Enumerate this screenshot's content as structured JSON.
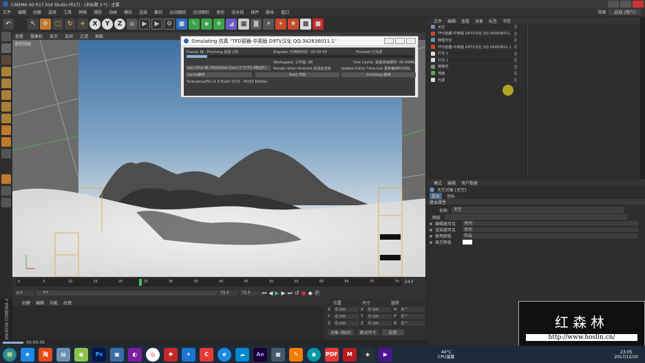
{
  "window_title": "CINEMA 4D R17.016 Studio (R17) - [未标题 3 *] - 主要",
  "menu": [
    "文件",
    "编辑",
    "创建",
    "选择",
    "工具",
    "网格",
    "捕捉",
    "动画",
    "模拟",
    "渲染",
    "雕刻",
    "运动跟踪",
    "运动图形",
    "角色",
    "流水线",
    "插件",
    "脚本",
    "窗口"
  ],
  "right_top": {
    "layout_label": "界面",
    "layout_value": "启动 (用户)"
  },
  "viewport": {
    "menu": [
      "查看",
      "摄像机",
      "显示",
      "选项",
      "过滤",
      "面板"
    ],
    "label": "透视视图"
  },
  "dialog": {
    "title": "Simulating 仿真 \"TFD容器-中英版 D9TV汉化 QQ:342836011.1\"",
    "frame": "Frame: 帧 , Finishing 完成 2间",
    "elapsed": "Elapsed: 已用的时间 : 00:00:40",
    "finished": "Finished 已完成",
    "workspace": "Workspace: 工作室: 08",
    "disk_cache": "Disk Cache: 磁盘高速缓存: 89.66MB",
    "cpu_select": "Use CPUs 用 CPUs(Intel Core i7-3770 4核/8T)",
    "render_check": "Render when finished 完成后渲染",
    "update_check": "Update Editor Time-line 更新编辑时间线(",
    "cache_select": "Cache缓存",
    "start_btn": "Start 开始",
    "continue_btn": "Continue 继续",
    "footer": "TurbulenceFD v1.0 Build 1372 - MUS3 Edition"
  },
  "objects": {
    "tabs": [
      "文件",
      "编辑",
      "查看",
      "对象",
      "标签",
      "书签"
    ],
    "items": [
      "天空",
      "TFD容器-中英版 D9TV汉化 QQ:342836011.1",
      "物理天空",
      "TFD容器-中英版 D9TV汉化 QQ:34283601.1",
      "灯光.1",
      "灯光.1",
      "摄像机",
      "地面",
      "光源"
    ]
  },
  "attributes": {
    "tabs": [
      "模式",
      "编辑",
      "用户数据"
    ],
    "object_label": "天空对象 [天空]",
    "subtabs": [
      "基本",
      "坐标"
    ],
    "section": "基本属性",
    "name_label": "名称",
    "name_value": "天空",
    "layer_label": "图层",
    "rows": [
      {
        "label": "编辑器可见",
        "value": "关闭"
      },
      {
        "label": "渲染器可见",
        "value": "关闭"
      },
      {
        "label": "使用颜色",
        "value": "开启"
      },
      {
        "label": "显示颜色",
        "value": ""
      }
    ]
  },
  "timeline": {
    "ticks": [
      "0",
      "5",
      "10",
      "15",
      "20",
      "25",
      "30",
      "35",
      "40",
      "45",
      "50",
      "55",
      "60",
      "65",
      "70",
      "75"
    ],
    "start": "0 F",
    "end": "75 F",
    "current": "0 F",
    "fps_label": "24 F",
    "end2": "75 F"
  },
  "bottom": {
    "menu": [
      "创建",
      "编辑",
      "功能",
      "纹理"
    ],
    "coord_headers": [
      "位置",
      "尺寸",
      "旋转"
    ],
    "coords": [
      [
        "X",
        "0 cm",
        "X",
        "0 cm",
        "H",
        "0 °"
      ],
      [
        "Y",
        "0 cm",
        "Y",
        "0 cm",
        "P",
        "0 °"
      ],
      [
        "Z",
        "0 cm",
        "Z",
        "0 cm",
        "B",
        "0 °"
      ]
    ],
    "object_mode": "对象 (相对)",
    "size_mode": "绝对尺寸",
    "apply_btn": "应用",
    "status_time": "00:00:45"
  },
  "watermark": {
    "title": "红森林",
    "url": "http://www.hoslin.cn/"
  },
  "taskbar": {
    "temp": "44°C",
    "temp_label": "CPU温度",
    "time": "23:05",
    "date": "2017/12/20"
  }
}
